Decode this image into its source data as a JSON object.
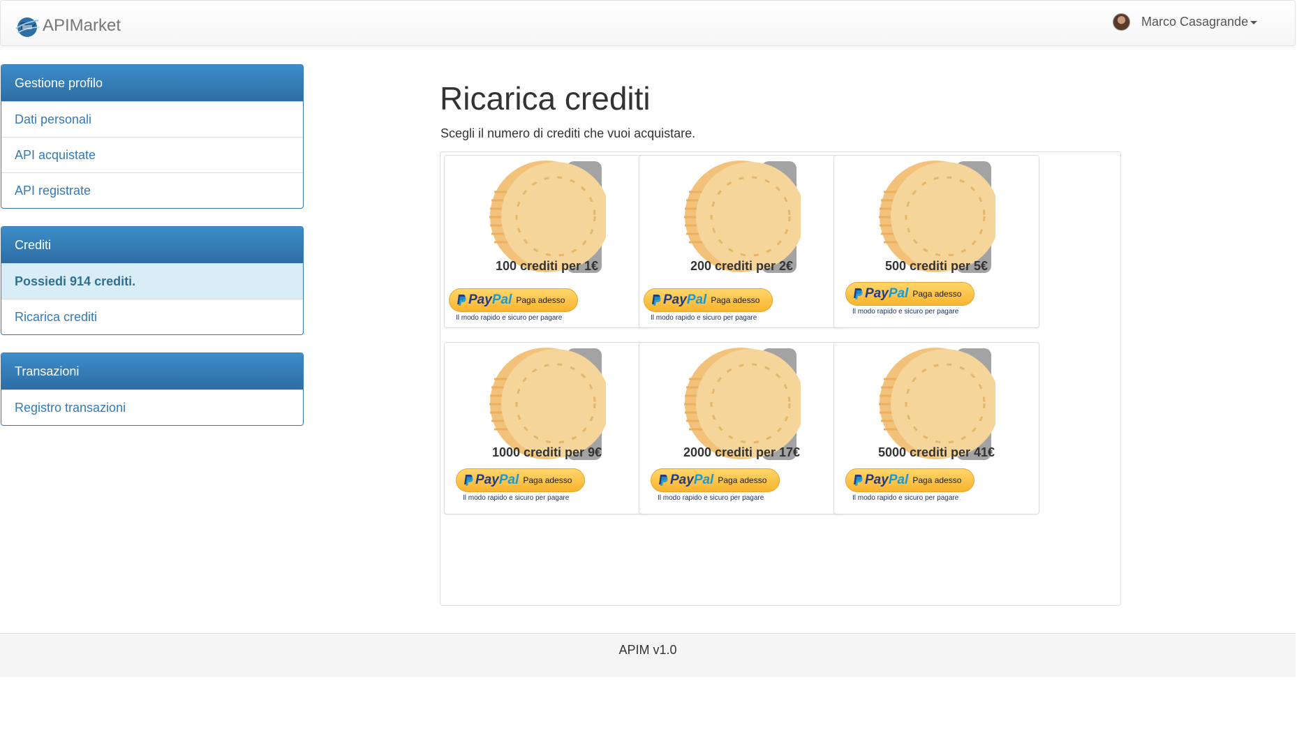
{
  "navbar": {
    "brand": "APIMarket",
    "user_name": "Marco Casagrande"
  },
  "sidebar": {
    "profile": {
      "heading": "Gestione profilo",
      "items": [
        {
          "label": "Dati personali"
        },
        {
          "label": "API acquistate"
        },
        {
          "label": "API registrate"
        }
      ]
    },
    "credits": {
      "heading": "Crediti",
      "balance": "Possiedi 914 crediti.",
      "items": [
        {
          "label": "Ricarica crediti"
        }
      ]
    },
    "transactions": {
      "heading": "Transazioni",
      "items": [
        {
          "label": "Registro transazioni"
        }
      ]
    }
  },
  "main": {
    "title": "Ricarica crediti",
    "subtitle": "Scegli il numero di crediti che vuoi acquistare.",
    "packages": [
      {
        "label": "100 crediti per 1€"
      },
      {
        "label": "200 crediti per 2€"
      },
      {
        "label": "500 crediti per 5€"
      },
      {
        "label": "1000 crediti per 9€"
      },
      {
        "label": "2000 crediti per 17€"
      },
      {
        "label": "5000 crediti per 41€"
      }
    ],
    "paypal": {
      "pay": "Pay",
      "pal": "Pal",
      "button_text": "Paga adesso",
      "tagline": "Il modo rapido e sicuro per pagare"
    }
  },
  "footer": {
    "text": "APIM v1.0"
  },
  "colors": {
    "primary": "#337ab7",
    "panel_info_bg": "#d9edf7",
    "coin": "#f5cf89",
    "paypal_yellow": "#ffc439"
  },
  "icons": {
    "brand": "globe-logo-icon",
    "coin": "coin-icon",
    "caret": "caret-down-icon"
  }
}
